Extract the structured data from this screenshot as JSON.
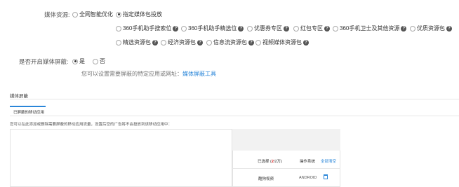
{
  "media_source": {
    "label": "媒体资源:",
    "options_row1": [
      {
        "label": "全网智能优化",
        "selected": false
      },
      {
        "label": "指定媒体包投放",
        "selected": true
      }
    ],
    "options_row2": [
      {
        "label": "360手机助手搜索位",
        "help": true
      },
      {
        "label": "360手机助手精选位",
        "help": true
      },
      {
        "label": "优惠券专区",
        "help": true
      },
      {
        "label": "红包专区",
        "help": true
      },
      {
        "label": "360手机卫士及其他资源",
        "help": true
      },
      {
        "label": "优质资源包",
        "help": true
      }
    ],
    "options_row3": [
      {
        "label": "精选资源包",
        "help": true
      },
      {
        "label": "经济资源包",
        "help": true
      },
      {
        "label": "信息流资源包",
        "help": true
      },
      {
        "label": "视频媒体资源包",
        "help": true
      }
    ]
  },
  "media_block": {
    "label": "是否开启媒体屏蔽:",
    "yes": "是",
    "no": "否",
    "hint_prefix": "您可以设置需要屏蔽的特定应用或网址：",
    "hint_link": "媒体屏蔽工具"
  },
  "section": {
    "title": "媒体屏蔽",
    "tab": "已屏蔽的移动应用",
    "description": "您可以在此添加或删除需要屏蔽的移动应用流量，设置后您的广告将不会投放到该移动应用中："
  },
  "selected_table": {
    "selected_prefix": "已选择 (",
    "selected_count": "2",
    "selected_unit": "/2万",
    "selected_suffix": ")",
    "col_os": "操作系统",
    "col_action": "全部清空",
    "rows": [
      {
        "name": "酷狗视频",
        "os": "ANDROID"
      }
    ]
  },
  "colors": {
    "accent": "#2a86d9",
    "red": "#e02020"
  },
  "icons": {
    "help": "help-icon",
    "delete": "trash-icon"
  }
}
